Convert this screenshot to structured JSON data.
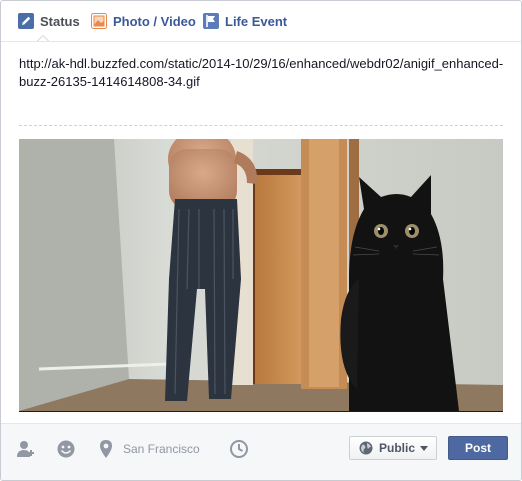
{
  "tabs": [
    {
      "label": "Status",
      "icon": "pencil-icon",
      "active": true
    },
    {
      "label": "Photo / Video",
      "icon": "photo-icon",
      "active": false
    },
    {
      "label": "Life Event",
      "icon": "flag-icon",
      "active": false
    }
  ],
  "status": {
    "text": "http://ak-hdl.buzzfed.com/static/2014-10/29/16/enhanced/webdr02/anigif_enhanced-buzz-26135-1414614808-34.gif"
  },
  "preview": {
    "image": "animated gif preview: man walking down hallway, black cat sitting in foreground"
  },
  "footer": {
    "location_label": "San Francisco",
    "audience_label": "Public",
    "post_label": "Post",
    "icons": [
      "tag-friends-icon",
      "feeling-icon",
      "location-pin-icon",
      "clock-icon"
    ]
  },
  "colors": {
    "link": "#3b5998",
    "post_button": "#4e69a2",
    "muted": "#9197a3"
  }
}
